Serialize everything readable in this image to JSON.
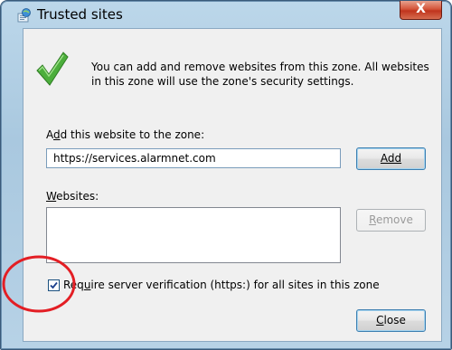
{
  "window": {
    "title": "Trusted sites",
    "close_glyph": "X",
    "accent_color": "#c0341d"
  },
  "info": {
    "icon": "checkmark-icon",
    "message": "You can add and remove websites from this zone. All websites in this zone will use the zone's security settings."
  },
  "add_section": {
    "label_prefix": "A",
    "label_underlined": "d",
    "label_rest": "d this website to the zone:",
    "url_value": "https://services.alarmnet.com",
    "add_button": "Add"
  },
  "websites_section": {
    "label_underlined": "W",
    "label_rest": "ebsites:",
    "items": [],
    "remove_button": "Remove"
  },
  "verification": {
    "checked": true,
    "label_prefix": "Req",
    "label_underlined": "u",
    "label_rest": "ire server verification (https:) for all sites in this zone"
  },
  "footer": {
    "close_button": "Close"
  },
  "annotation_color": "#e31e24"
}
